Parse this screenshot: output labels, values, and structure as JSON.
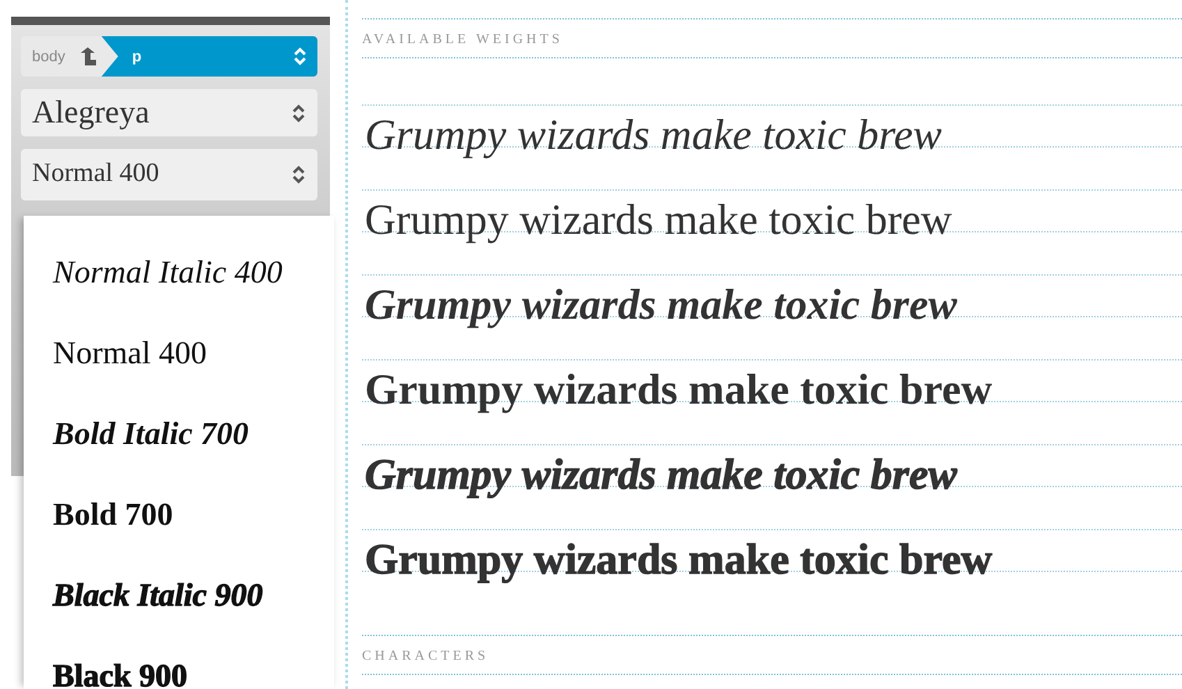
{
  "breadcrumb": {
    "parent": "body",
    "current": "p"
  },
  "font_select": {
    "value": "Alegreya"
  },
  "weight_select": {
    "value": "Normal 400"
  },
  "weight_menu": [
    {
      "label": "Normal Italic 400",
      "italic": true,
      "kind": "normal"
    },
    {
      "label": "Normal 400",
      "italic": false,
      "kind": "normal"
    },
    {
      "label": "Bold Italic 700",
      "italic": true,
      "kind": "bold"
    },
    {
      "label": "Bold 700",
      "italic": false,
      "kind": "bold"
    },
    {
      "label": "Black Italic 900",
      "italic": true,
      "kind": "black"
    },
    {
      "label": "Black 900",
      "italic": false,
      "kind": "black"
    }
  ],
  "sections": [
    {
      "heading": "AVAILABLE WEIGHTS",
      "samples": [
        {
          "text": "Grumpy wizards make toxic brew",
          "italic": true,
          "kind": "normal"
        },
        {
          "text": "Grumpy wizards make toxic brew",
          "italic": false,
          "kind": "normal"
        },
        {
          "text": "Grumpy wizards make toxic brew",
          "italic": true,
          "kind": "bold"
        },
        {
          "text": "Grumpy wizards make toxic brew",
          "italic": false,
          "kind": "bold"
        },
        {
          "text": "Grumpy wizards make toxic brew",
          "italic": true,
          "kind": "black"
        },
        {
          "text": "Grumpy wizards make toxic brew",
          "italic": false,
          "kind": "black"
        }
      ]
    },
    {
      "heading": "CHARACTERS"
    }
  ]
}
